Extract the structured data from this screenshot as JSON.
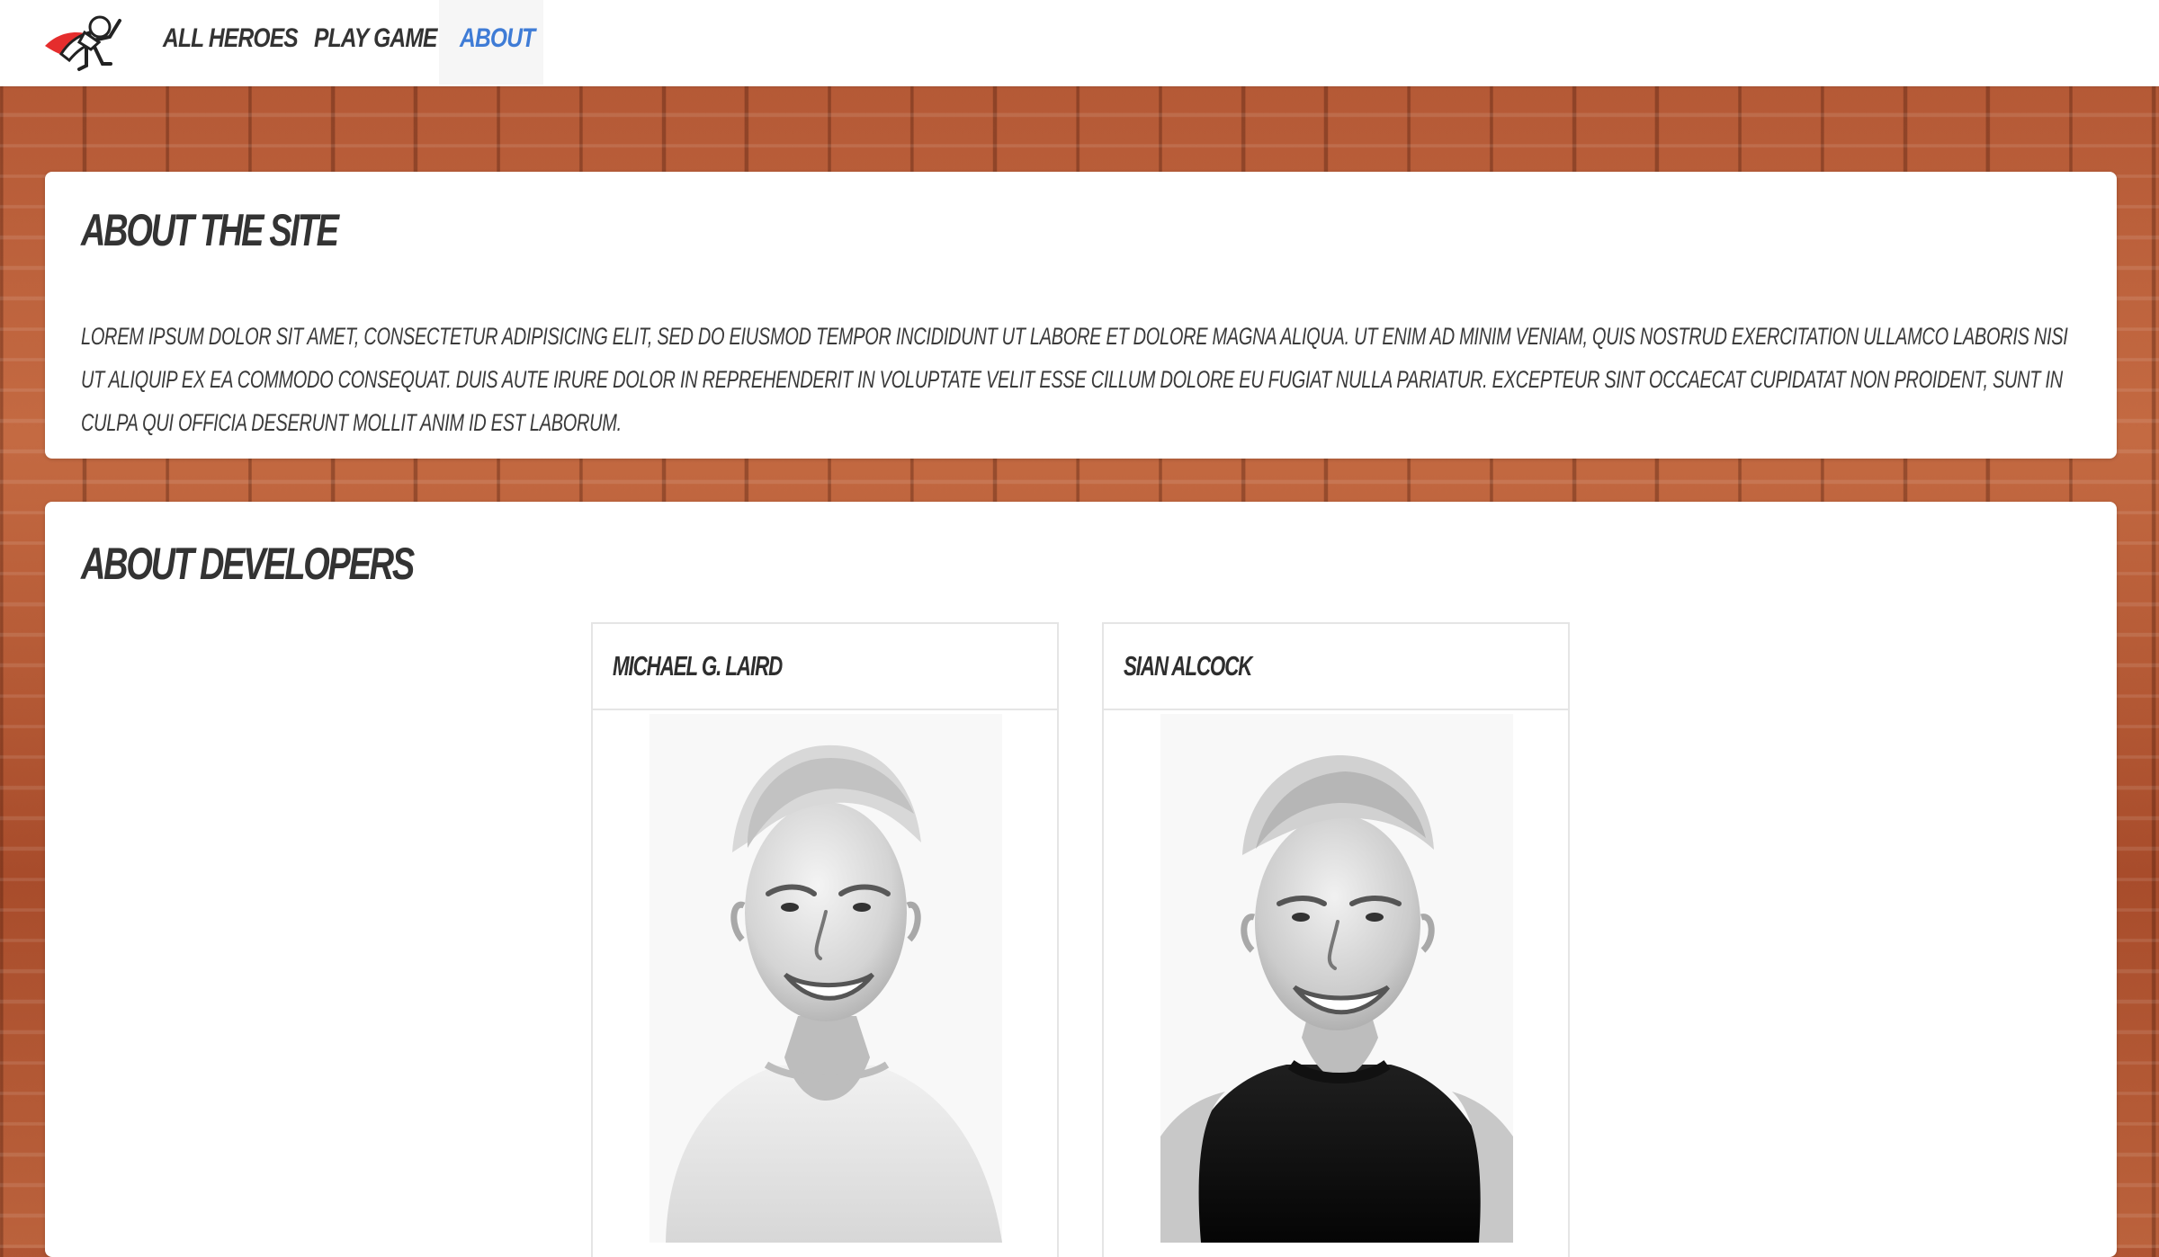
{
  "nav": {
    "logo_icon": "superhero-logo-icon",
    "items": [
      {
        "label": "All Heroes",
        "active": false
      },
      {
        "label": "Play Game",
        "active": false
      },
      {
        "label": "About",
        "active": true
      }
    ],
    "active_color": "#3f7cd6"
  },
  "about_site": {
    "title": "About the site",
    "text": "Lorem ipsum dolor sit amet, consectetur adipisicing elit, sed do eiusmod tempor incididunt ut labore et dolore magna aliqua. Ut enim ad minim veniam, quis nostrud exercitation ullamco laboris nisi ut aliquip ex ea commodo consequat. Duis aute irure dolor in reprehenderit in voluptate velit esse cillum dolore eu fugiat nulla pariatur. Excepteur sint occaecat cupidatat non proident, sunt in culpa qui officia deserunt mollit anim id est laborum."
  },
  "about_developers": {
    "title": "About developers",
    "developers": [
      {
        "name": "Michael G. Laird",
        "photo": "portrait-photo"
      },
      {
        "name": "Sian Alcock",
        "photo": "portrait-photo"
      }
    ]
  },
  "colors": {
    "background": "#b75a38",
    "panel": "#ffffff",
    "text": "#333333"
  }
}
